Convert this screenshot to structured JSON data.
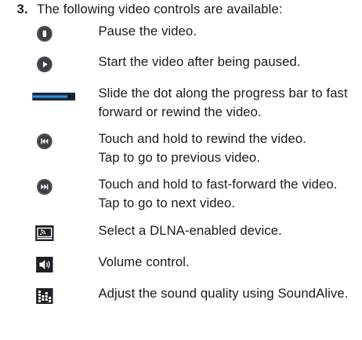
{
  "step": {
    "number": "3.",
    "heading": "The following video controls are available:"
  },
  "controls": [
    {
      "icon": "pause-icon",
      "lines": [
        "Pause the video."
      ]
    },
    {
      "icon": "play-icon",
      "lines": [
        "Start the video after being paused."
      ]
    },
    {
      "icon": "progress-bar-icon",
      "lines": [
        "Slide the dot along the progress bar to fast",
        "forward or rewind the video."
      ]
    },
    {
      "icon": "rewind-icon",
      "lines": [
        "Touch and hold to rewind the video.",
        "Tap to go to previous video."
      ]
    },
    {
      "icon": "fast-forward-icon",
      "lines": [
        "Touch and hold to fast-forward the video.",
        "Tap to go to next video."
      ]
    },
    {
      "icon": "dlna-icon",
      "lines": [
        "Select a DLNA-enabled device."
      ]
    },
    {
      "icon": "volume-icon",
      "lines": [
        "Volume control."
      ]
    },
    {
      "icon": "soundalive-icon",
      "lines": [
        "Adjust the sound quality using SoundAlive."
      ]
    }
  ],
  "colors": {
    "icon_dark": "#3c3f44",
    "icon_light": "#ffffff",
    "progress_blue": "#2f8fd8",
    "progress_track": "#1b2a3a"
  }
}
